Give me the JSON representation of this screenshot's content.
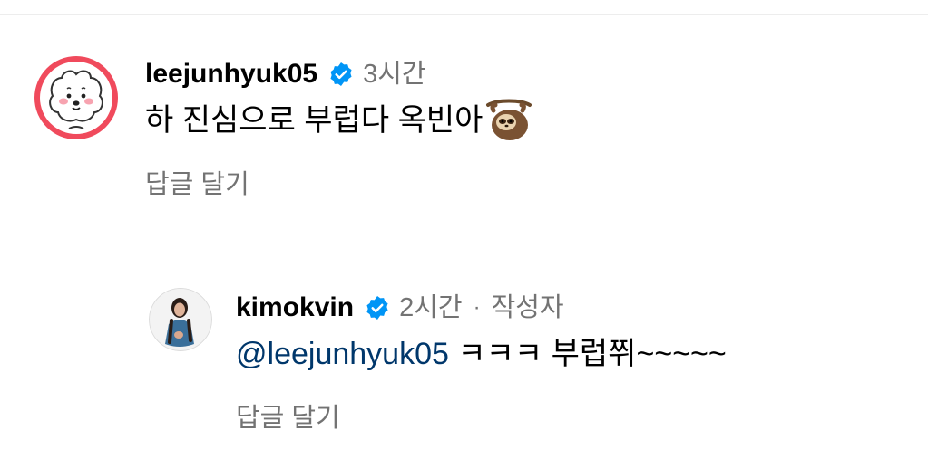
{
  "comments": [
    {
      "username": "leejunhyuk05",
      "time": "3시간",
      "text": "하 진심으로 부럽다 옥빈아",
      "emoji": "sloth",
      "reply_label": "답글 달기",
      "verified": true
    }
  ],
  "reply": {
    "username": "kimokvin",
    "time": "2시간",
    "separator": "·",
    "author_badge": "작성자",
    "mention": "@leejunhyuk05",
    "text": " ㅋㅋㅋ 부럽쮜~~~~~",
    "reply_label": "답글 달기",
    "verified": true
  },
  "colors": {
    "verified_blue": "#0095f6",
    "mention": "#00376b",
    "secondary_text": "#737373",
    "avatar_ring": "#f04a5c"
  }
}
